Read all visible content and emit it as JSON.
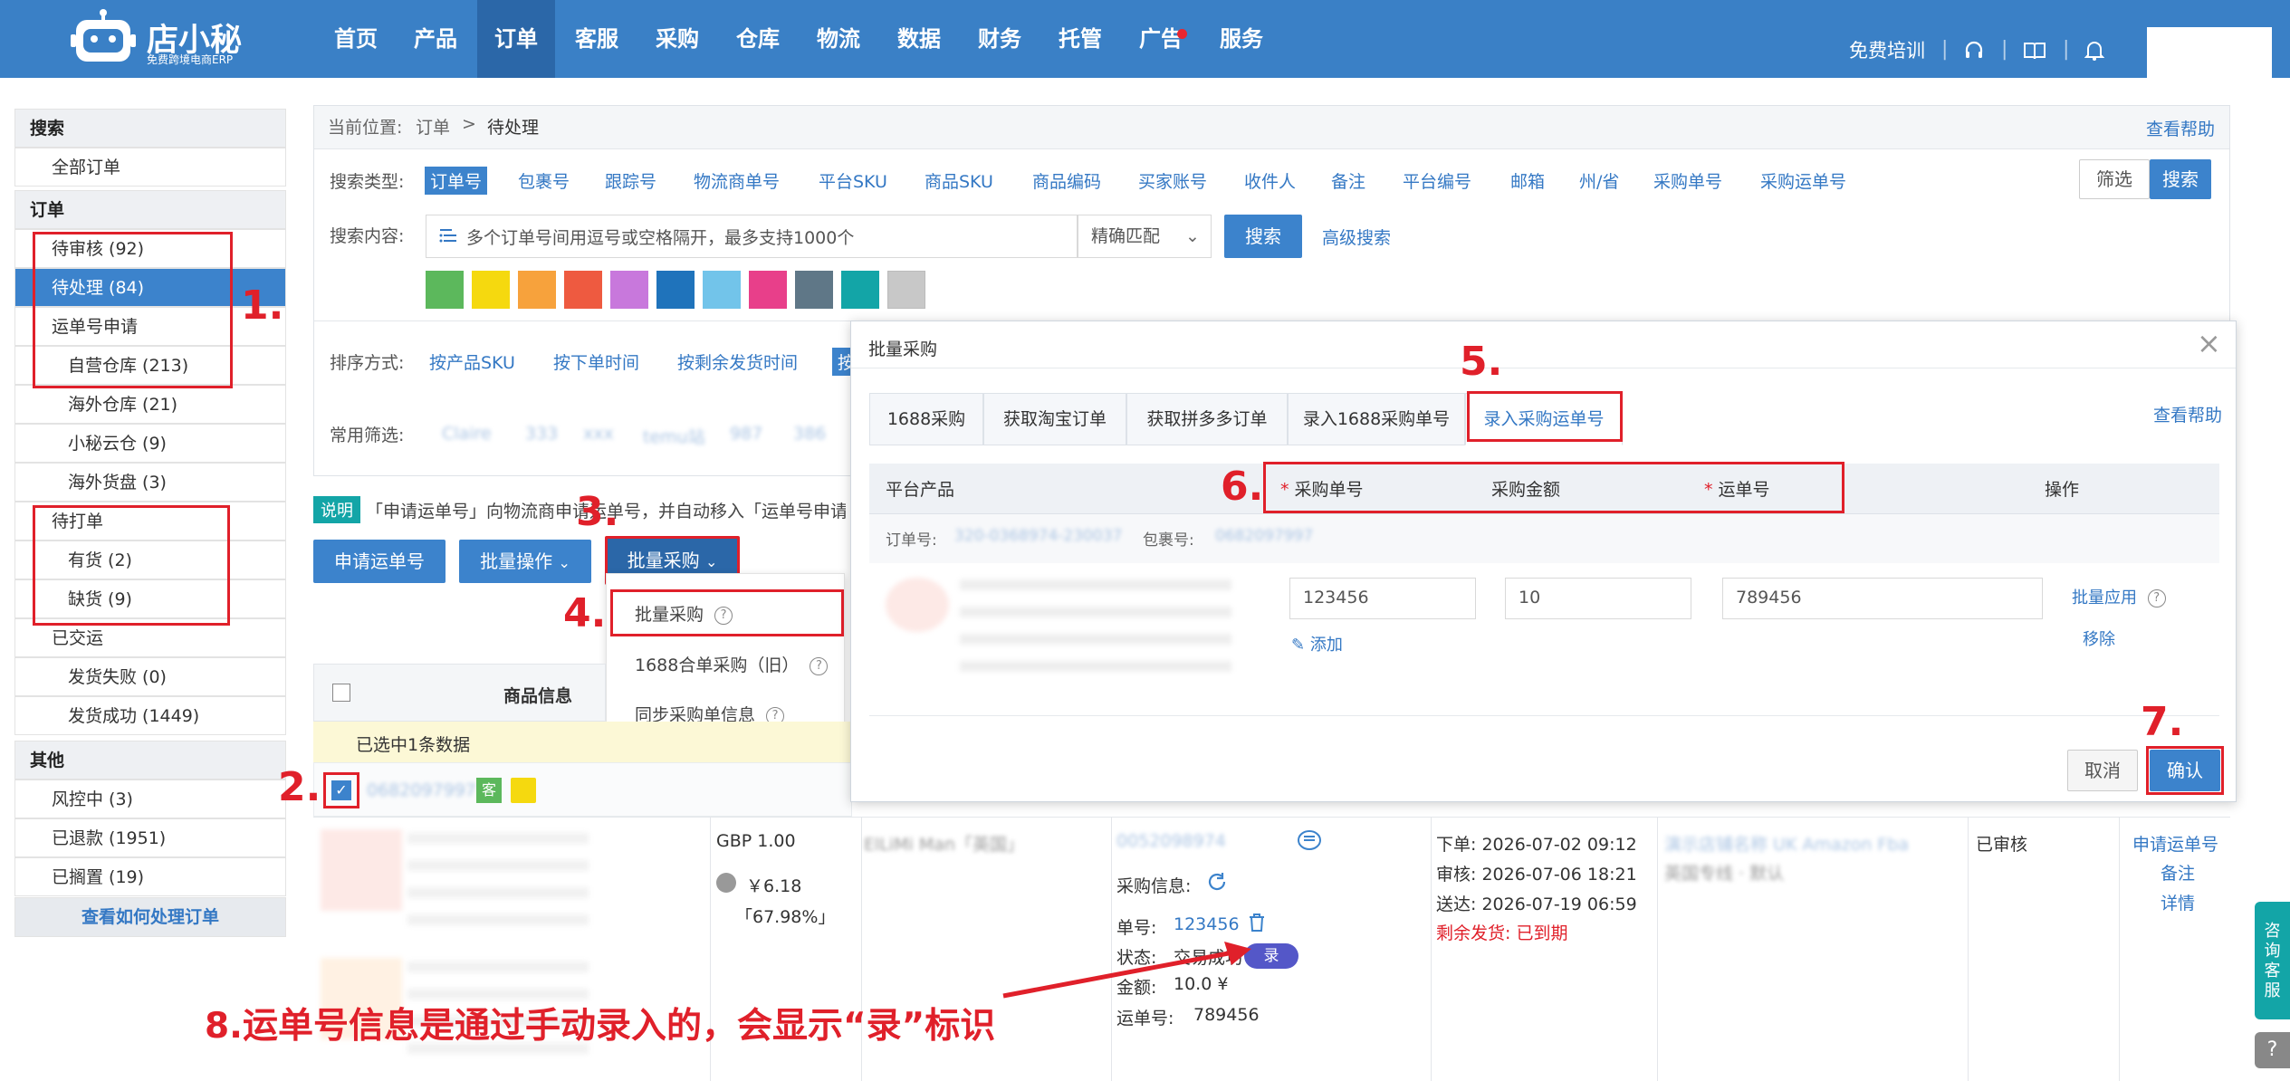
{
  "app": {
    "logo_text": "店小秘",
    "logo_sub": "免费跨境电商ERP"
  },
  "nav": [
    {
      "label": "首页"
    },
    {
      "label": "产品"
    },
    {
      "label": "订单"
    },
    {
      "label": "客服"
    },
    {
      "label": "采购"
    },
    {
      "label": "仓库"
    },
    {
      "label": "物流"
    },
    {
      "label": "数据"
    },
    {
      "label": "财务"
    },
    {
      "label": "托管"
    },
    {
      "label": "广告"
    },
    {
      "label": "服务"
    }
  ],
  "topright": {
    "training": "免费培训",
    "sep": "|"
  },
  "sidebar": {
    "search_h": "搜索",
    "all_orders": "全部订单",
    "order_h": "订单",
    "items": [
      "待审核 (92)",
      "待处理 (84)",
      "运单号申请",
      "自营仓库 (213)",
      "海外仓库 (21)",
      "小秘云仓 (9)",
      "海外货盘 (3)",
      "待打单",
      "有货 (2)",
      "缺货 (9)",
      "已交运",
      "发货失败 (0)",
      "发货成功 (1449)"
    ],
    "other_h": "其他",
    "other_items": [
      "风控中 (3)",
      "已退款 (1951)",
      "已搁置 (19)"
    ],
    "footer": "查看如何处理订单"
  },
  "steps": {
    "s1": "1.",
    "s2": "2.",
    "s3": "3.",
    "s4": "4.",
    "s5": "5.",
    "s6": "6.",
    "s7": "7."
  },
  "breadcrumb": {
    "prefix": "当前位置:",
    "l1": "订单",
    "sep": ">",
    "l2": "待处理",
    "help": "查看帮助"
  },
  "search": {
    "type_label": "搜索类型:",
    "types": [
      "订单号",
      "包裹号",
      "跟踪号",
      "物流商单号",
      "平台SKU",
      "商品SKU",
      "商品编码",
      "买家账号",
      "收件人",
      "备注",
      "平台编号",
      "邮箱",
      "州/省",
      "采购单号",
      "采购运单号"
    ],
    "filter_btn": "筛选",
    "search_btn_top": "搜索",
    "content_label": "搜索内容:",
    "placeholder": "多个订单号间用逗号或空格隔开，最多支持1000个",
    "match": "精确匹配",
    "search_btn": "搜索",
    "advanced": "高级搜索"
  },
  "colors": [
    "#5cb85c",
    "#f5d90f",
    "#f7a23c",
    "#ee5a40",
    "#c878dc",
    "#1f73bb",
    "#72c4ea",
    "#e83f8a",
    "#5f7787",
    "#13a5a7",
    "#c8c8c8"
  ],
  "sort": {
    "label": "排序方式:",
    "opts": [
      "按产品SKU",
      "按下单时间",
      "按剩余发货时间",
      "按"
    ]
  },
  "common_filter": {
    "label": "常用筛选:",
    "blurred": [
      "Claire",
      "333",
      "xxx",
      "temu站",
      "987",
      "386"
    ]
  },
  "notice": {
    "tag": "说明",
    "text": "「申请运单号」向物流商申请运单号，并自动移入「运单号申请"
  },
  "actions": {
    "apply": "申请运单号",
    "batch_op": "批量操作",
    "batch_purchase": "批量采购"
  },
  "dropdown": {
    "items": [
      "批量采购",
      "1688合单采购（旧）",
      "同步采购单信息"
    ]
  },
  "table": {
    "product_info": "商品信息",
    "selected_text": "已选中1条数据",
    "row": {
      "order_no_blurred": "0682097997",
      "tag": "客",
      "price": "GBP 1.00",
      "cost": "￥6.18",
      "ratio": "「67.98%」",
      "buyer_blurred": "ElLiMi Man「英国」",
      "purchase_label": "采购信息:",
      "single_no_label": "单号:",
      "single_no": "123456",
      "status_label": "状态:",
      "status": "交易成功",
      "lu_badge": "录",
      "amount_label": "金额:",
      "amount": "10.0 ¥",
      "waybill_label": "运单号:",
      "waybill": "789456",
      "order_time": "下单: 2026-07-02 09:12",
      "audit_time": "审核: 2026-07-06 18:21",
      "deliver_time": "送达: 2026-07-19 06:59",
      "remain": "剩余发货: 已到期",
      "reviewed": "已审核",
      "op1": "申请运单号",
      "op2": "备注",
      "op3": "详情"
    }
  },
  "modal": {
    "title": "批量采购",
    "close": "×",
    "tabs": [
      "1688采购",
      "获取淘宝订单",
      "获取拼多多订单",
      "录入1688采购单号",
      "录入采购运单号"
    ],
    "help": "查看帮助",
    "col_product": "平台产品",
    "col_purchase_no": "采购单号",
    "col_amount": "采购金额",
    "col_waybill": "运单号",
    "col_op": "操作",
    "order_no_label": "订单号:",
    "package_no_label": "包裹号:",
    "purchase_no_value": "123456",
    "amount_value": "10",
    "waybill_value": "789456",
    "add": "添加",
    "batch_apply": "批量应用",
    "remove": "移除",
    "cancel": "取消",
    "confirm": "确认"
  },
  "annotation": "8.运单号信息是通过手动录入的，会显示“录”标识",
  "float": {
    "consult": "咨询客服"
  }
}
